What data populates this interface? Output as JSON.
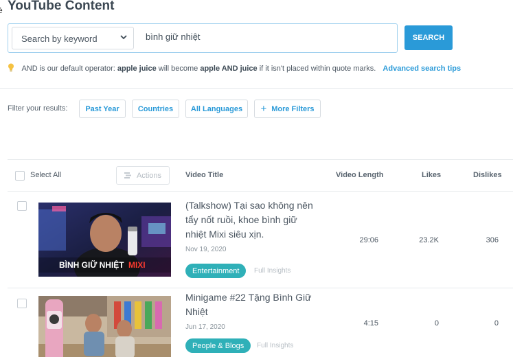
{
  "page": {
    "title": "YouTube Content"
  },
  "search": {
    "mode_label": "Search by keyword",
    "query": "bình giữ nhiệt",
    "button_label": "SEARCH"
  },
  "hint": {
    "prefix": "AND is our default operator:",
    "example_a": "apple juice",
    "middle": "will become",
    "example_b": "apple AND juice",
    "suffix": "if it isn't placed within quote marks.",
    "link": "Advanced search tips"
  },
  "filters": {
    "label": "Filter your results:",
    "buttons": [
      "Past Year",
      "Countries",
      "All Languages"
    ],
    "more_label": "More Filters"
  },
  "table": {
    "select_all": "Select All",
    "actions_label": "Actions",
    "columns": {
      "title": "Video Title",
      "length": "Video Length",
      "likes": "Likes",
      "dislikes": "Dislikes"
    },
    "rows": [
      {
        "title": "(Talkshow) Tại sao không nên tẩy nốt ruồi, khoe bình giữ nhiệt Mixi siêu xịn.",
        "date": "Nov 19, 2020",
        "category": "Entertainment",
        "insights": "Full Insights",
        "length": "29:06",
        "likes": "23.2K",
        "dislikes": "306",
        "thumb_caption_a": "BÌNH GIỮ NHIỆT",
        "thumb_caption_b": "MIXI"
      },
      {
        "title": "Minigame #22 Tặng Bình Giữ Nhiệt",
        "date": "Jun 17, 2020",
        "category": "People & Blogs",
        "insights": "Full Insights",
        "length": "4:15",
        "likes": "0",
        "dislikes": "0"
      }
    ]
  },
  "colors": {
    "accent": "#2a9ad8",
    "tag": "#2fb0b8",
    "border": "#e6e9ec"
  }
}
